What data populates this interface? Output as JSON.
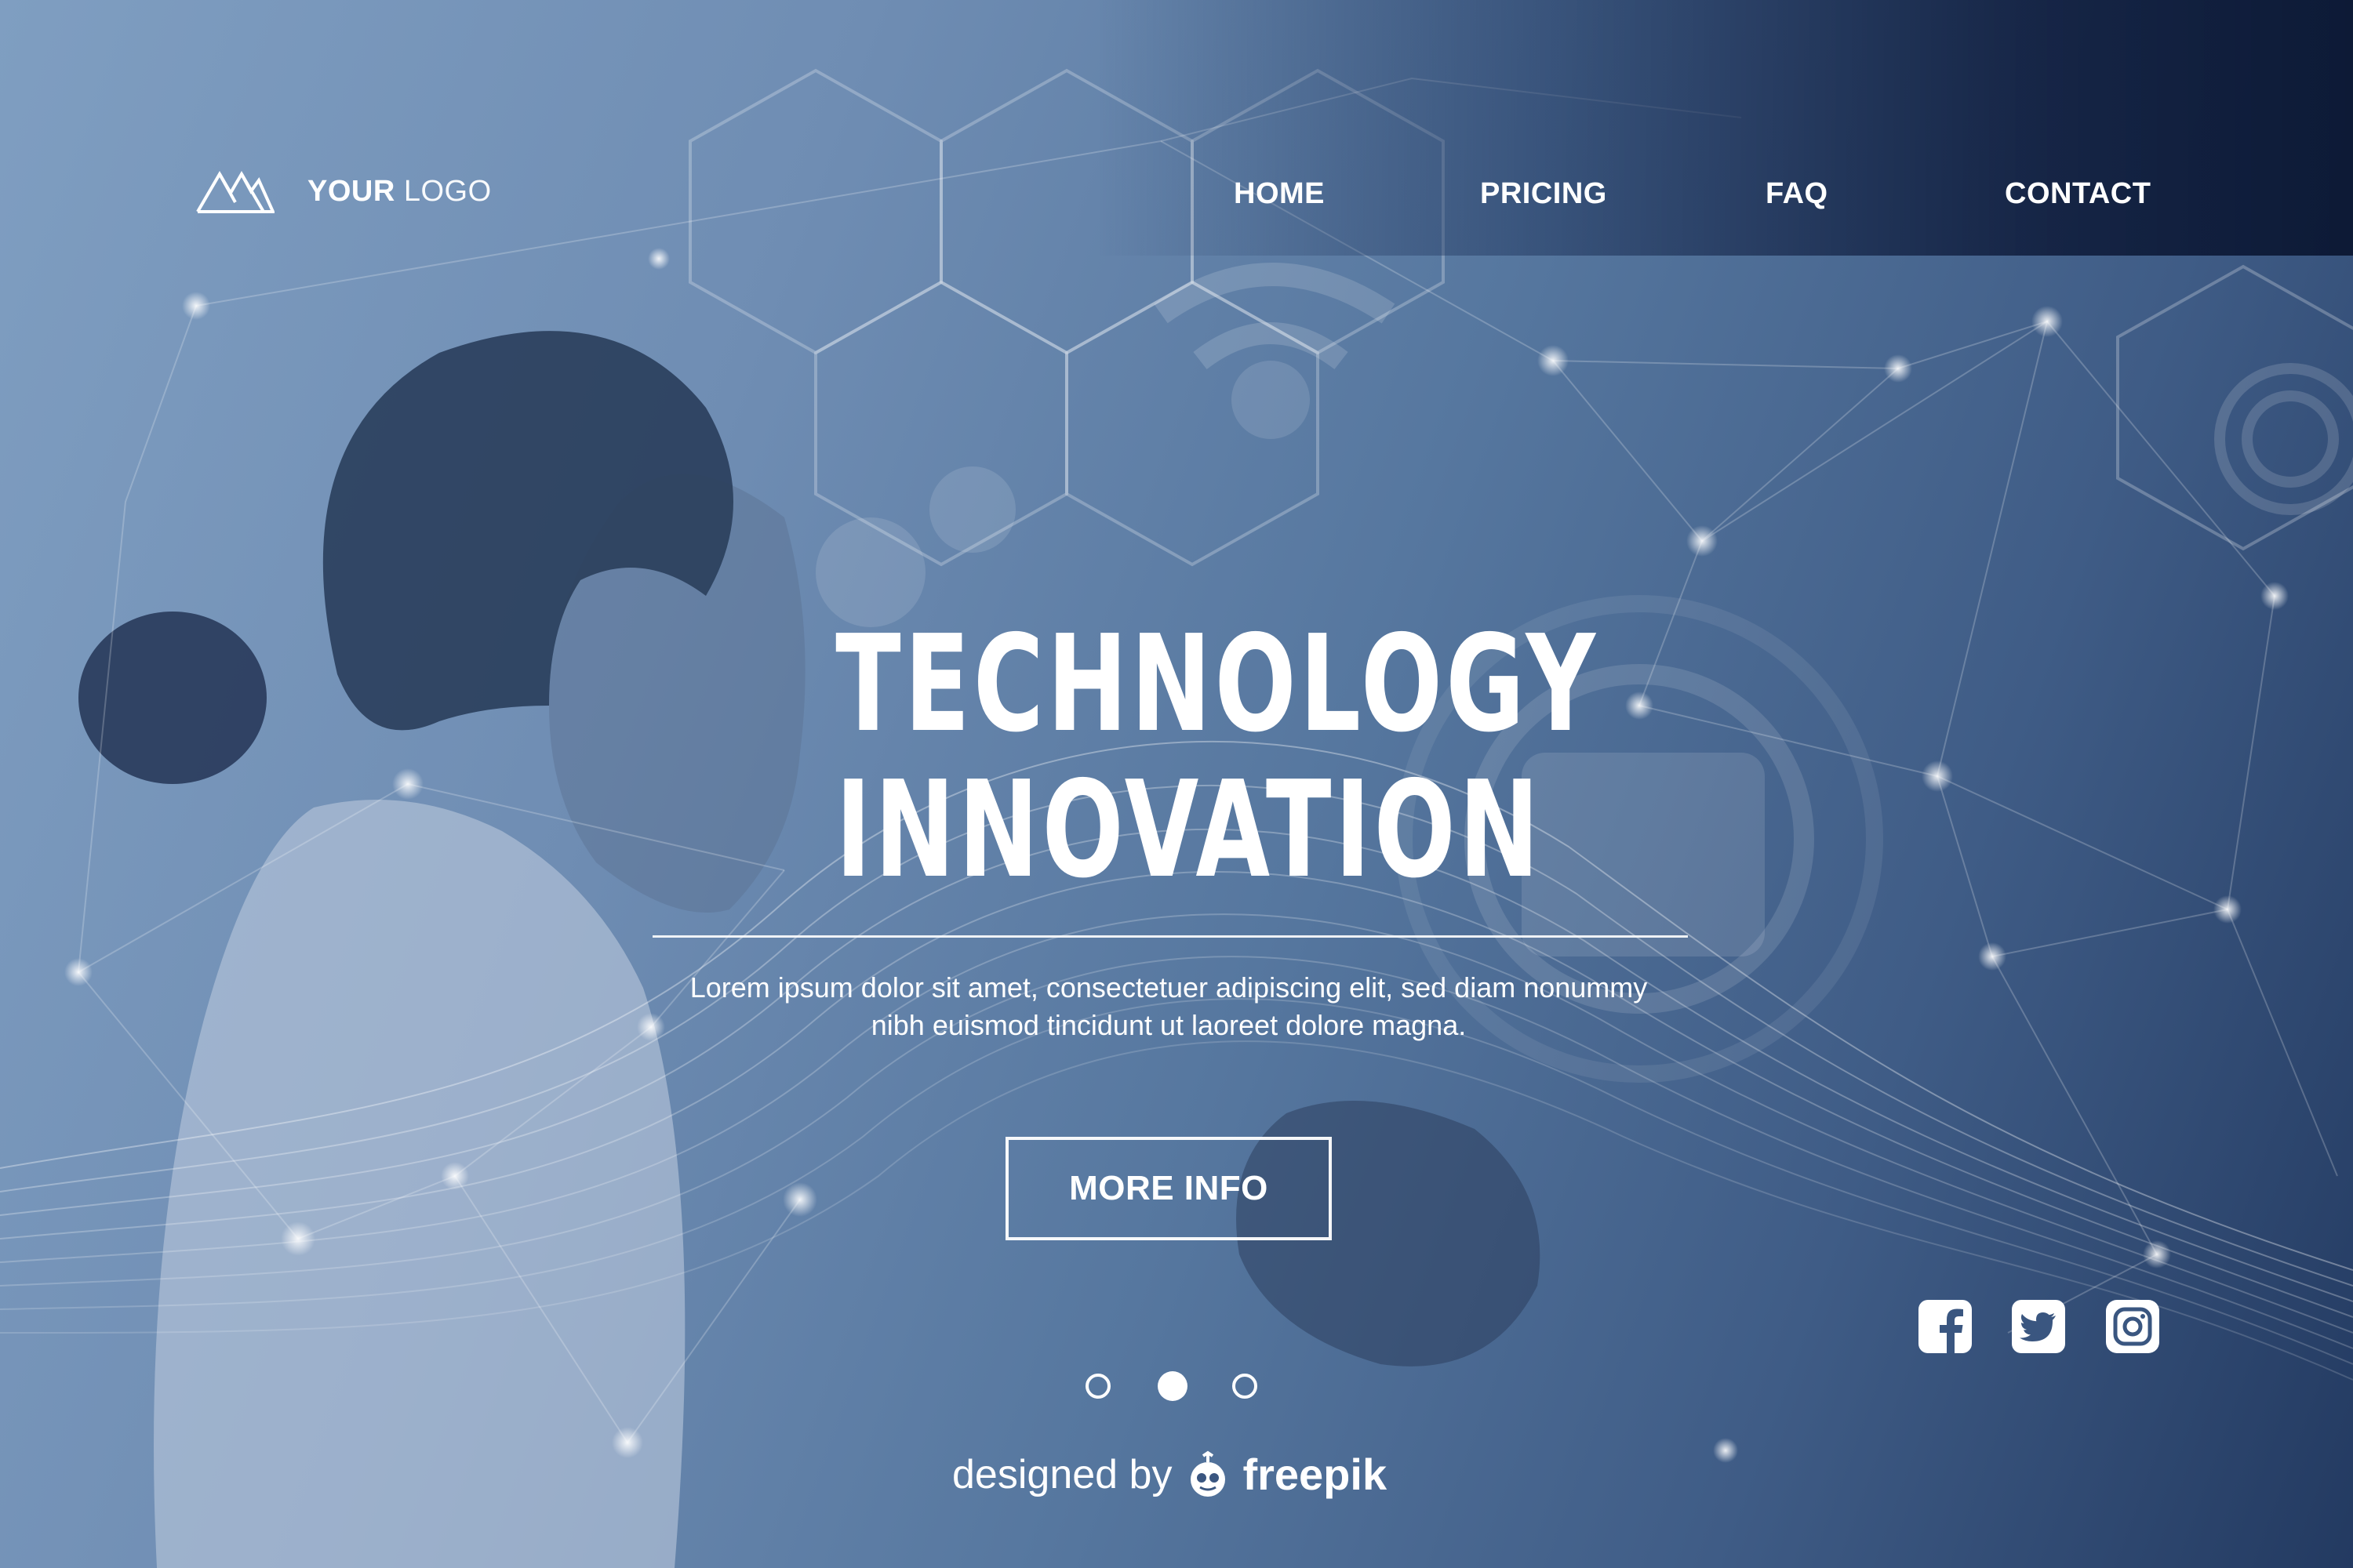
{
  "logo": {
    "icon": "mountains-icon",
    "text_bold": "YOUR",
    "text_light": "LOGO"
  },
  "nav": {
    "items": [
      {
        "label": "HOME"
      },
      {
        "label": "PRICING"
      },
      {
        "label": "FAQ"
      },
      {
        "label": "CONTACT"
      }
    ]
  },
  "hero": {
    "title_line1": "TECHNOLOGY",
    "title_line2": "INNOVATION",
    "subtitle_line1": "Lorem ipsum dolor sit amet, consectetuer adipiscing elit, sed diam nonummy",
    "subtitle_line2": "nibh euismod tincidunt ut laoreet dolore magna.",
    "cta_label": "MORE INFO"
  },
  "carousel": {
    "count": 3,
    "active_index": 1
  },
  "social": [
    {
      "icon": "facebook-icon"
    },
    {
      "icon": "twitter-icon"
    },
    {
      "icon": "instagram-icon"
    }
  ],
  "credit": {
    "prefix": "designed by",
    "brand": "freepik",
    "icon": "freepik-mascot-icon"
  },
  "colors": {
    "background_light": "#7f9ec1",
    "background_dark": "#0d1a36",
    "text": "#ffffff"
  }
}
